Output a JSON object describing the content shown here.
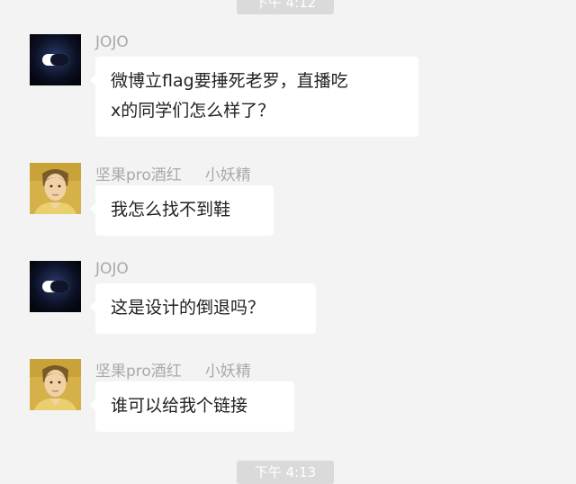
{
  "timestamps": {
    "top": "下午 4:12",
    "bottom": "下午 4:13"
  },
  "messages": [
    {
      "sender": "JOJO",
      "alias": "",
      "avatar": "dark-oval-avatar",
      "lines": [
        "微博立flag要捶死老罗，直播吃",
        "x的同学们怎么样了？"
      ]
    },
    {
      "sender": "坚果pro酒红",
      "alias": "小妖精",
      "avatar": "portrait-avatar",
      "lines": [
        "我怎么找不到鞋"
      ]
    },
    {
      "sender": "JOJO",
      "alias": "",
      "avatar": "dark-oval-avatar",
      "lines": [
        "这是设计的倒退吗？"
      ]
    },
    {
      "sender": "坚果pro酒红",
      "alias": "小妖精",
      "avatar": "portrait-avatar",
      "lines": [
        "谁可以给我个链接"
      ]
    }
  ],
  "colors": {
    "background": "#f3f3f3",
    "bubble": "#ffffff",
    "sender_text": "#a9a9a9",
    "message_text": "#222222",
    "time_chip": "#dadada"
  }
}
